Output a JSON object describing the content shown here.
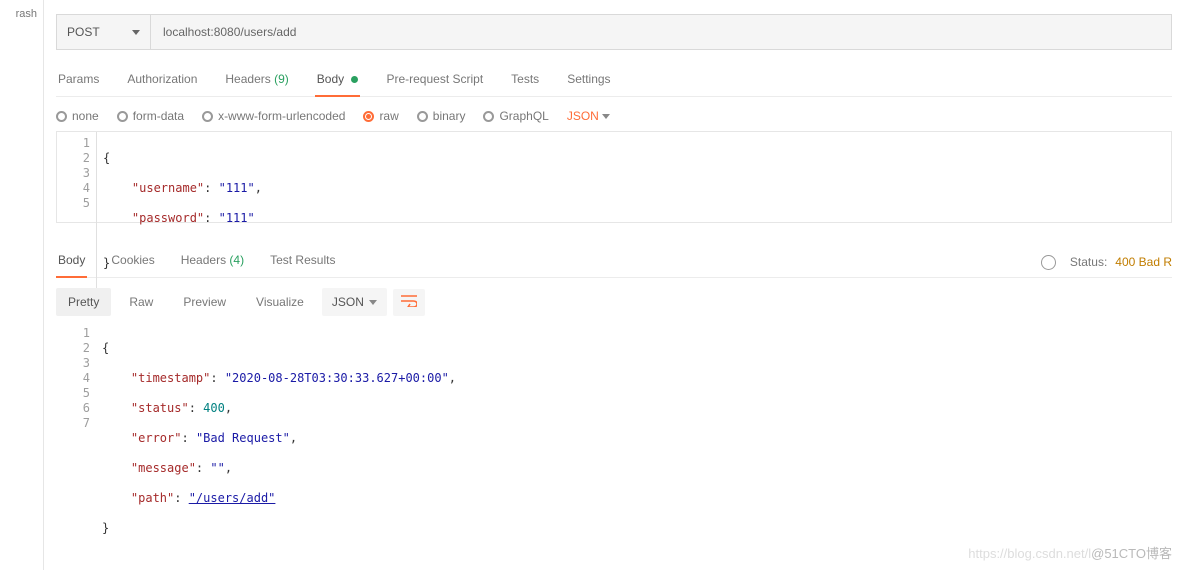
{
  "sidebar": {
    "trash": "rash"
  },
  "request": {
    "method": "POST",
    "url": "localhost:8080/users/add"
  },
  "reqTabs": {
    "params": "Params",
    "auth": "Authorization",
    "headers": "Headers",
    "headersCount": "(9)",
    "body": "Body",
    "prereq": "Pre-request Script",
    "tests": "Tests",
    "settings": "Settings"
  },
  "bodyTypes": {
    "none": "none",
    "formData": "form-data",
    "urlenc": "x-www-form-urlencoded",
    "raw": "raw",
    "binary": "binary",
    "graphql": "GraphQL",
    "lang": "JSON"
  },
  "reqGutter": {
    "l1": "1",
    "l2": "2",
    "l3": "3",
    "l4": "4",
    "l5": "5"
  },
  "reqCode": {
    "l1": "{",
    "l2a": "    \"username\"",
    "l2b": ": ",
    "l2c": "\"111\"",
    "l2d": ",",
    "l3a": "    \"password\"",
    "l3b": ": ",
    "l3c": "\"111\"",
    "l4": "",
    "l5": "}"
  },
  "respTabs": {
    "body": "Body",
    "cookies": "Cookies",
    "headers": "Headers",
    "headersCount": "(4)",
    "testResults": "Test Results",
    "statusLabel": "Status:",
    "statusValue": "400 Bad R"
  },
  "viewbar": {
    "pretty": "Pretty",
    "raw": "Raw",
    "preview": "Preview",
    "visualize": "Visualize",
    "lang": "JSON"
  },
  "respGutter": {
    "l1": "1",
    "l2": "2",
    "l3": "3",
    "l4": "4",
    "l5": "5",
    "l6": "6",
    "l7": "7"
  },
  "respCode": {
    "l1": "{",
    "l2a": "    \"timestamp\"",
    "l2b": ": ",
    "l2c": "\"2020-08-28T03:30:33.627+00:00\"",
    "l2d": ",",
    "l3a": "    \"status\"",
    "l3b": ": ",
    "l3c": "400",
    "l3d": ",",
    "l4a": "    \"error\"",
    "l4b": ": ",
    "l4c": "\"Bad Request\"",
    "l4d": ",",
    "l5a": "    \"message\"",
    "l5b": ": ",
    "l5c": "\"\"",
    "l5d": ",",
    "l6a": "    \"path\"",
    "l6b": ": ",
    "l6c": "\"/users/add\"",
    "l7": "}"
  },
  "watermark": {
    "faint": "https://blog.csdn.net/l",
    "dark": "@51CTO博客"
  }
}
